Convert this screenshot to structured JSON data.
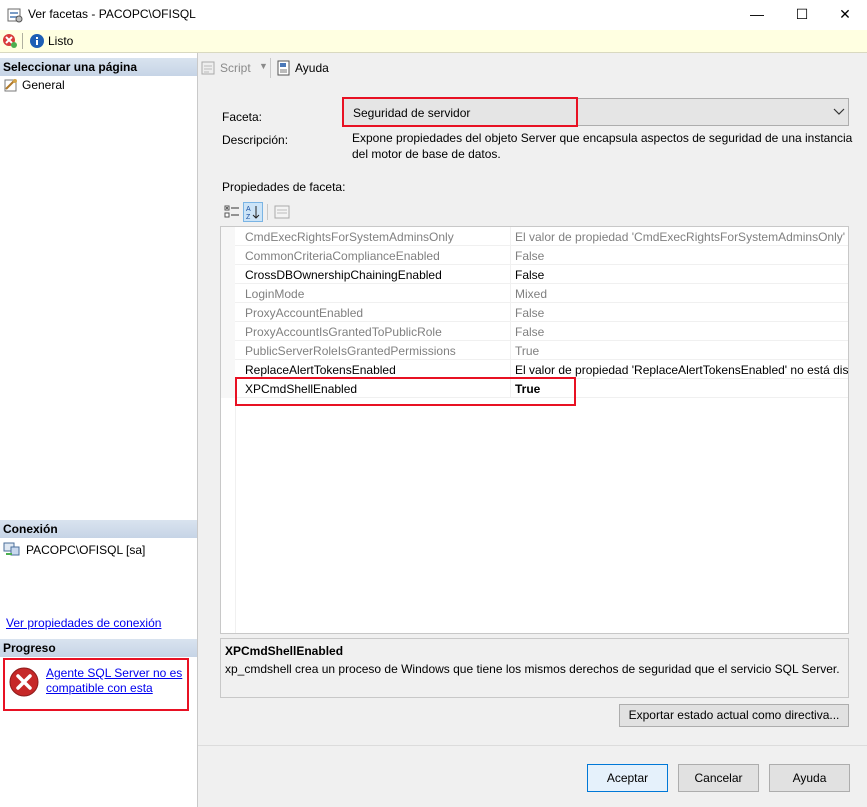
{
  "window": {
    "title": "Ver facetas - PACOPC\\OFISQL",
    "minimize": "—",
    "maximize": "☐",
    "close": "✕"
  },
  "status": {
    "text": "Listo"
  },
  "left": {
    "select_page_header": "Seleccionar una página",
    "pages": [
      {
        "label": "General"
      }
    ],
    "connection_header": "Conexión",
    "connection_value": "PACOPC\\OFISQL [sa]",
    "connection_link": "Ver propiedades de conexión",
    "progress_header": "Progreso",
    "progress_line1": "Agente SQL Server no es",
    "progress_line2": "compatible con esta"
  },
  "toolbar": {
    "script_label": "Script",
    "help_label": "Ayuda"
  },
  "facet": {
    "label": "Faceta:",
    "selected": "Seguridad de servidor",
    "description_label": "Descripción:",
    "description_line1": "Expone propiedades del objeto Server que encapsula aspectos de seguridad de una instancia",
    "description_line2": "del motor de base de datos.",
    "properties_label": "Propiedades de faceta:"
  },
  "properties": [
    {
      "name": "CmdExecRightsForSystemAdminsOnly",
      "value": "El valor de propiedad 'CmdExecRightsForSystemAdminsOnly' n",
      "enabled": false
    },
    {
      "name": "CommonCriteriaComplianceEnabled",
      "value": "False",
      "enabled": false
    },
    {
      "name": "CrossDBOwnershipChainingEnabled",
      "value": "False",
      "enabled": true
    },
    {
      "name": "LoginMode",
      "value": "Mixed",
      "enabled": false
    },
    {
      "name": "ProxyAccountEnabled",
      "value": "False",
      "enabled": false
    },
    {
      "name": "ProxyAccountIsGrantedToPublicRole",
      "value": "False",
      "enabled": false
    },
    {
      "name": "PublicServerRoleIsGrantedPermissions",
      "value": "True",
      "enabled": false
    },
    {
      "name": "ReplaceAlertTokensEnabled",
      "value": "El valor de propiedad 'ReplaceAlertTokensEnabled' no está dispo",
      "enabled": true
    },
    {
      "name": "XPCmdShellEnabled",
      "value": "True",
      "enabled": true,
      "bold_value": true
    }
  ],
  "selected_property": {
    "name": "XPCmdShellEnabled",
    "description": "xp_cmdshell crea un proceso de Windows que tiene los mismos derechos de seguridad que el servicio SQL Server."
  },
  "buttons": {
    "export": "Exportar estado actual como directiva...",
    "ok": "Aceptar",
    "cancel": "Cancelar",
    "help": "Ayuda"
  },
  "colors": {
    "highlight_red": "#e81123",
    "link_blue": "#0000ee",
    "status_yellow": "#ffffe1"
  }
}
